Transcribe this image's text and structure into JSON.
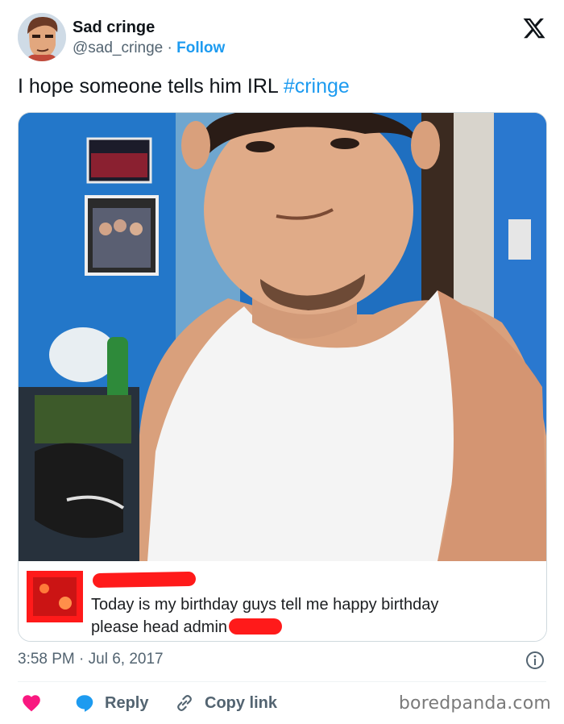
{
  "author": {
    "display_name": "Sad cringe",
    "handle": "@sad_cringe",
    "separator": "·",
    "follow_label": "Follow"
  },
  "tweet": {
    "text": "I hope someone tells him IRL ",
    "hashtag": "#cringe"
  },
  "media": {
    "caption_line1": "Today is my birthday guys tell me happy birthday",
    "caption_line2": "please head admin"
  },
  "meta": {
    "timestamp": "3:58 PM · Jul 6, 2017"
  },
  "actions": {
    "reply_label": "Reply",
    "copy_label": "Copy link"
  },
  "watermark": "boredpanda.com",
  "colors": {
    "accent": "#1d9bf0",
    "heart": "#f91880",
    "redaction": "#ff1a1a"
  }
}
